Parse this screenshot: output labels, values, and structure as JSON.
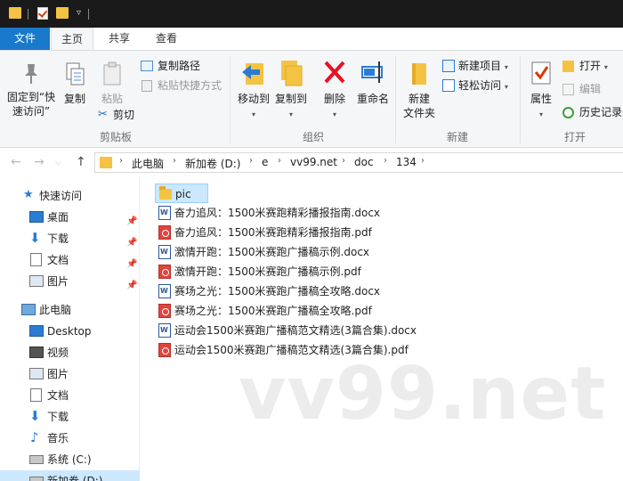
{
  "menu": {
    "file": "文件",
    "home": "主页",
    "share": "共享",
    "view": "查看"
  },
  "ribbon": {
    "clipboard": {
      "pin": "固定到“快\n速访问”",
      "pin_line1": "固定到“快",
      "pin_line2": "速访问”",
      "copy": "复制",
      "paste": "粘贴",
      "copy_path": "复制路径",
      "paste_shortcut": "粘贴快捷方式",
      "cut": "剪切",
      "group": "剪贴板"
    },
    "organize": {
      "move_to": "移动到",
      "copy_to": "复制到",
      "delete": "删除",
      "rename": "重命名",
      "group": "组织"
    },
    "new": {
      "new_folder_line1": "新建",
      "new_folder_line2": "文件夹",
      "new_item": "新建项目",
      "easy_access": "轻松访问",
      "group": "新建"
    },
    "open": {
      "properties": "属性",
      "open": "打开",
      "edit": "编辑",
      "history": "历史记录",
      "group": "打开"
    }
  },
  "address": {
    "crumbs": [
      "此电脑",
      "新加卷 (D:)",
      "e",
      "vv99.net",
      "doc",
      "134"
    ]
  },
  "sidebar": {
    "items": [
      {
        "label": "快速访问",
        "icon": "star-icon"
      },
      {
        "label": "桌面",
        "icon": "desktop-icon",
        "pinned": true
      },
      {
        "label": "下载",
        "icon": "download-icon",
        "pinned": true
      },
      {
        "label": "文档",
        "icon": "document-icon",
        "pinned": true
      },
      {
        "label": "图片",
        "icon": "picture-icon",
        "pinned": true
      },
      {
        "label": "此电脑",
        "icon": "computer-icon"
      },
      {
        "label": "Desktop",
        "icon": "desktop-icon"
      },
      {
        "label": "视频",
        "icon": "video-icon"
      },
      {
        "label": "图片",
        "icon": "picture-icon"
      },
      {
        "label": "文档",
        "icon": "document-icon"
      },
      {
        "label": "下载",
        "icon": "download-icon"
      },
      {
        "label": "音乐",
        "icon": "music-icon"
      },
      {
        "label": "系统 (C:)",
        "icon": "drive-icon"
      },
      {
        "label": "新加卷 (D:)",
        "icon": "drive-icon"
      }
    ]
  },
  "files": [
    {
      "name": "pic",
      "type": "folder"
    },
    {
      "name": "奋力追风：1500米赛跑精彩播报指南.docx",
      "type": "docx"
    },
    {
      "name": "奋力追风：1500米赛跑精彩播报指南.pdf",
      "type": "pdf"
    },
    {
      "name": "激情开跑：1500米赛跑广播稿示例.docx",
      "type": "docx"
    },
    {
      "name": "激情开跑：1500米赛跑广播稿示例.pdf",
      "type": "pdf"
    },
    {
      "name": "赛场之光：1500米赛跑广播稿全攻略.docx",
      "type": "docx"
    },
    {
      "name": "赛场之光：1500米赛跑广播稿全攻略.pdf",
      "type": "pdf"
    },
    {
      "name": "运动会1500米赛跑广播稿范文精选(3篇合集).docx",
      "type": "docx"
    },
    {
      "name": "运动会1500米赛跑广播稿范文精选(3篇合集).pdf",
      "type": "pdf"
    }
  ],
  "watermark": "vv99.net",
  "colors": {
    "accent": "#1979ca",
    "selection": "#cce8ff",
    "delete_red": "#e81123",
    "folder": "#f5c343"
  }
}
